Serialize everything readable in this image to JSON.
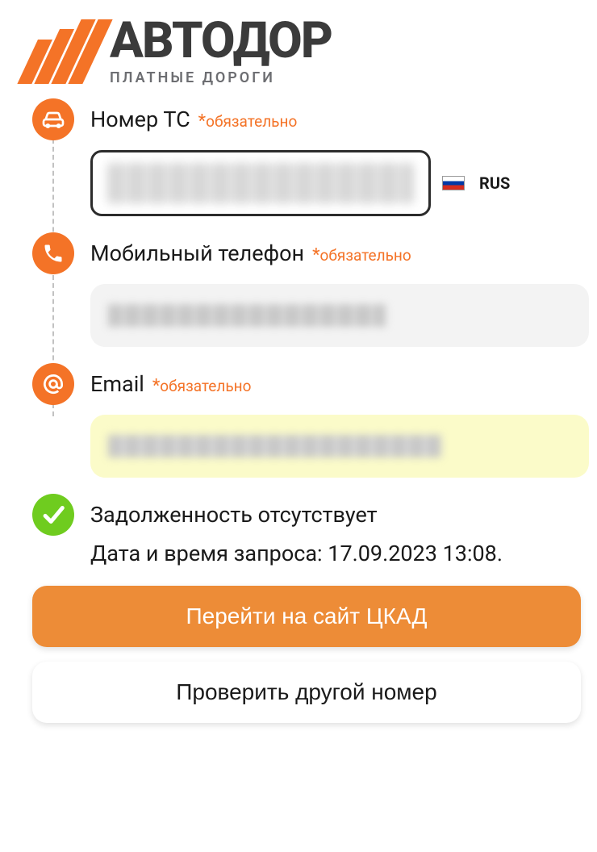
{
  "logo": {
    "text": "АВТОДОР",
    "subtext": "ПЛАТНЫЕ ДОРОГИ"
  },
  "fields": {
    "vehicle": {
      "label": "Номер ТС",
      "required_text": "обязательно",
      "country": "RUS"
    },
    "phone": {
      "label": "Мобильный телефон",
      "required_text": "обязательно"
    },
    "email": {
      "label": "Email",
      "required_text": "обязательно"
    }
  },
  "result": {
    "status_text": "Задолженность отсутствует",
    "request_line": "Дата и время запроса: 17.09.2023 13:08."
  },
  "buttons": {
    "primary": "Перейти на сайт ЦКАД",
    "secondary": "Проверить другой номер"
  }
}
